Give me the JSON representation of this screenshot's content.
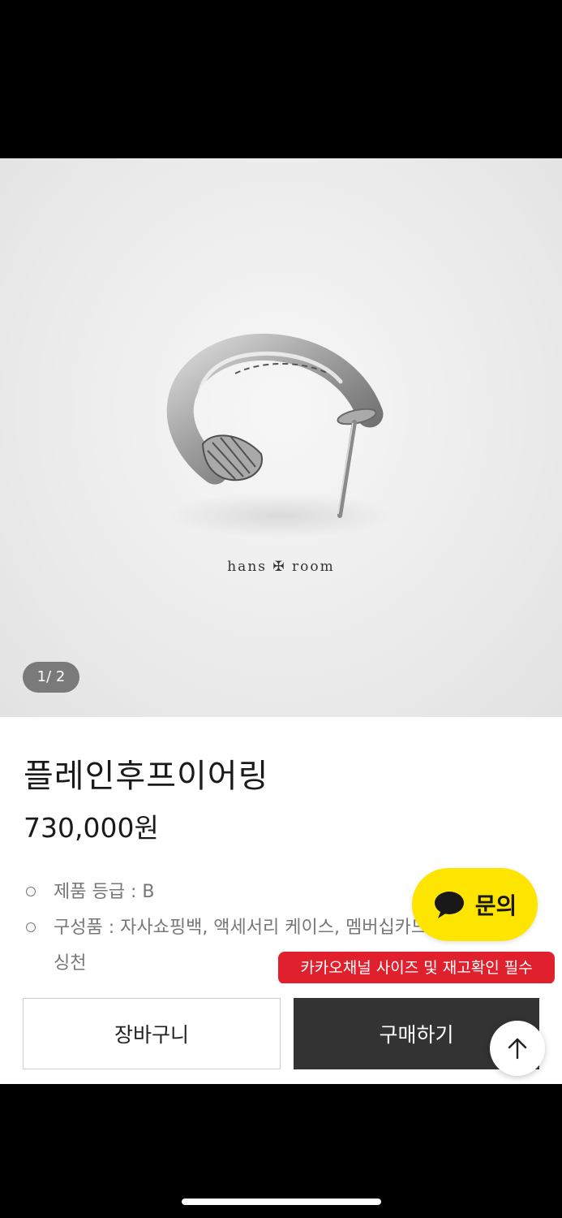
{
  "gallery": {
    "watermark": "hans ✠ room",
    "counter": "1/ 2"
  },
  "product": {
    "name": "플레인후프이어링",
    "price": "730,000원",
    "specs": [
      "제품 등급 : B",
      "구성품 : 자사쇼핑백, 액세서리 케이스, 멤버십카드, 실버",
      "싱천"
    ]
  },
  "kakao": {
    "label": "문의",
    "color": "#fee500",
    "tooltip": "카카오채널 사이즈 및 재고확인 필수",
    "tooltip_color": "#e0202d"
  },
  "actions": {
    "cart_label": "장바구니",
    "buy_label": "구매하기"
  },
  "icons": {
    "chat": "chat-bubble-icon",
    "scroll_top": "arrow-up-icon"
  }
}
